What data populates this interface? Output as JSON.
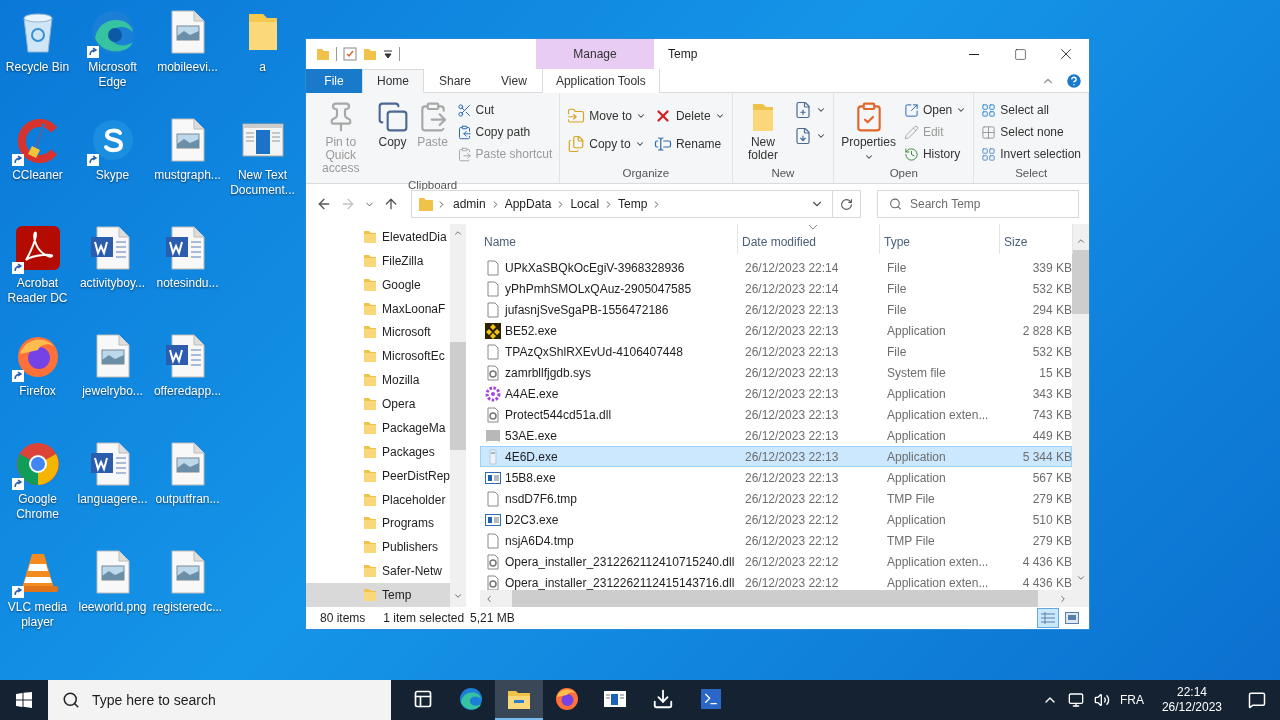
{
  "desktop": {
    "icons": [
      {
        "label": "Recycle Bin",
        "kind": "recycle",
        "shortcut": false
      },
      {
        "label": "CCleaner",
        "kind": "ccleaner",
        "shortcut": true
      },
      {
        "label": "Acrobat Reader DC",
        "kind": "acrobat",
        "shortcut": true
      },
      {
        "label": "Firefox",
        "kind": "firefox",
        "shortcut": true
      },
      {
        "label": "Google Chrome",
        "kind": "chrome",
        "shortcut": true
      },
      {
        "label": "VLC media player",
        "kind": "vlc",
        "shortcut": true
      },
      {
        "label": "Microsoft Edge",
        "kind": "edge",
        "shortcut": true
      },
      {
        "label": "Skype",
        "kind": "skype",
        "shortcut": true
      },
      {
        "label": "activityboy...",
        "kind": "word",
        "shortcut": false
      },
      {
        "label": "jewelrybo...",
        "kind": "image",
        "shortcut": false
      },
      {
        "label": "languagere...",
        "kind": "word",
        "shortcut": false
      },
      {
        "label": "leeworld.png",
        "kind": "image",
        "shortcut": false
      },
      {
        "label": "mobileevi...",
        "kind": "image",
        "shortcut": false
      },
      {
        "label": "mustgraph...",
        "kind": "image",
        "shortcut": false
      },
      {
        "label": "notesindu...",
        "kind": "word",
        "shortcut": false
      },
      {
        "label": "offeredapp...",
        "kind": "word",
        "shortcut": false
      },
      {
        "label": "outputfran...",
        "kind": "image",
        "shortcut": false
      },
      {
        "label": "registeredc...",
        "kind": "image",
        "shortcut": false
      },
      {
        "label": "a",
        "kind": "folder",
        "shortcut": false
      },
      {
        "label": "New Text Document...",
        "kind": "window",
        "shortcut": false
      }
    ]
  },
  "window": {
    "contextual_tab": "Manage",
    "title": "Temp",
    "tabs": [
      {
        "label": "File",
        "kind": "file",
        "selected": false
      },
      {
        "label": "Home",
        "kind": "tab",
        "selected": true
      },
      {
        "label": "Share",
        "kind": "tab",
        "selected": false
      },
      {
        "label": "View",
        "kind": "tab",
        "selected": false
      },
      {
        "label": "Application Tools",
        "kind": "contextual",
        "selected": false
      }
    ],
    "ribbon": {
      "groups": [
        {
          "label": "Clipboard",
          "columns": [
            [
              {
                "label": "Pin to Quick access",
                "kind": "large",
                "dropdown": false,
                "disabled": true
              }
            ],
            [
              {
                "label": "Copy",
                "kind": "large",
                "dropdown": false,
                "disabled": false
              }
            ],
            [
              {
                "label": "Paste",
                "kind": "large",
                "dropdown": false,
                "disabled": true
              }
            ],
            [
              {
                "label": "Cut",
                "kind": "small",
                "dropdown": false,
                "disabled": false
              },
              {
                "label": "Copy path",
                "kind": "small",
                "dropdown": false,
                "disabled": false
              },
              {
                "label": "Paste shortcut",
                "kind": "small",
                "dropdown": false,
                "disabled": true
              }
            ]
          ]
        },
        {
          "label": "Organize",
          "columns": [
            [
              {
                "label": "Move to",
                "kind": "medium",
                "dropdown": true,
                "disabled": false
              },
              {
                "label": "Copy to",
                "kind": "medium",
                "dropdown": true,
                "disabled": false
              }
            ],
            [
              {
                "label": "Delete",
                "kind": "medium",
                "dropdown": true,
                "disabled": false
              },
              {
                "label": "Rename",
                "kind": "medium",
                "dropdown": false,
                "disabled": false
              }
            ]
          ]
        },
        {
          "label": "New",
          "columns": [
            [
              {
                "label": "New folder",
                "kind": "large",
                "dropdown": false,
                "disabled": false
              }
            ],
            [
              {
                "kind": "icon",
                "dropdown": true,
                "disabled": false
              },
              {
                "kind": "icon",
                "dropdown": true,
                "disabled": false
              }
            ]
          ]
        },
        {
          "label": "Open",
          "columns": [
            [
              {
                "label": "Properties",
                "kind": "large",
                "dropdown": true,
                "disabled": false
              }
            ],
            [
              {
                "label": "Open",
                "kind": "small",
                "dropdown": true,
                "disabled": false
              },
              {
                "label": "Edit",
                "kind": "small",
                "dropdown": false,
                "disabled": true
              },
              {
                "label": "History",
                "kind": "small",
                "dropdown": false,
                "disabled": false
              }
            ]
          ]
        },
        {
          "label": "Select",
          "columns": [
            [
              {
                "label": "Select all",
                "kind": "small",
                "dropdown": false,
                "disabled": false
              },
              {
                "label": "Select none",
                "kind": "small",
                "dropdown": false,
                "disabled": false
              },
              {
                "label": "Invert selection",
                "kind": "small",
                "dropdown": false,
                "disabled": false
              }
            ]
          ]
        }
      ]
    },
    "address": {
      "breadcrumb": [
        "admin",
        "AppData",
        "Local",
        "Temp"
      ],
      "search_placeholder": "Search Temp"
    },
    "nav": {
      "items": [
        {
          "label": "ElevatedDia",
          "selected": false
        },
        {
          "label": "FileZilla",
          "selected": false
        },
        {
          "label": "Google",
          "selected": false
        },
        {
          "label": "MaxLoonaF",
          "selected": false
        },
        {
          "label": "Microsoft",
          "selected": false
        },
        {
          "label": "MicrosoftEc",
          "selected": false
        },
        {
          "label": "Mozilla",
          "selected": false
        },
        {
          "label": "Opera",
          "selected": false
        },
        {
          "label": "PackageMa",
          "selected": false
        },
        {
          "label": "Packages",
          "selected": false
        },
        {
          "label": "PeerDistRep",
          "selected": false
        },
        {
          "label": "Placeholder",
          "selected": false
        },
        {
          "label": "Programs",
          "selected": false
        },
        {
          "label": "Publishers",
          "selected": false
        },
        {
          "label": "Safer-Netw",
          "selected": false
        },
        {
          "label": "Temp",
          "selected": true
        }
      ]
    },
    "files": {
      "columns": [
        {
          "label": "Name",
          "sorted": false
        },
        {
          "label": "Date modified",
          "sorted": true
        },
        {
          "label": "Type",
          "sorted": false
        },
        {
          "label": "Size",
          "sorted": false
        }
      ],
      "rows": [
        {
          "name": "UPkXaSBQkOcEgiV-3968328936",
          "date": "26/12/2023 22:14",
          "type": "File",
          "size": "339 KB",
          "kind": "blank",
          "selected": false
        },
        {
          "name": "yPhPmhSMOLxQAuz-2905047585",
          "date": "26/12/2023 22:14",
          "type": "File",
          "size": "532 KB",
          "kind": "blank",
          "selected": false
        },
        {
          "name": "jufasnjSveSgaPB-1556472186",
          "date": "26/12/2023 22:13",
          "type": "File",
          "size": "294 KB",
          "kind": "blank",
          "selected": false
        },
        {
          "name": "BE52.exe",
          "date": "26/12/2023 22:13",
          "type": "Application",
          "size": "2 828 KB",
          "kind": "pattern",
          "selected": false
        },
        {
          "name": "TPAzQxShlRXEvUd-4106407448",
          "date": "26/12/2023 22:13",
          "type": "File",
          "size": "532 KB",
          "kind": "blank",
          "selected": false
        },
        {
          "name": "zamrbllfjgdb.sys",
          "date": "26/12/2023 22:13",
          "type": "System file",
          "size": "15 KB",
          "kind": "gear-page",
          "selected": false
        },
        {
          "name": "A4AE.exe",
          "date": "26/12/2023 22:13",
          "type": "Application",
          "size": "343 KB",
          "kind": "gear",
          "selected": false
        },
        {
          "name": "Protect544cd51a.dll",
          "date": "26/12/2023 22:13",
          "type": "Application exten...",
          "size": "743 KB",
          "kind": "gear-page",
          "selected": false
        },
        {
          "name": "53AE.exe",
          "date": "26/12/2023 22:13",
          "type": "Application",
          "size": "449 KB",
          "kind": "grey-app",
          "selected": false
        },
        {
          "name": "4E6D.exe",
          "date": "26/12/2023 22:13",
          "type": "Application",
          "size": "5 344 KB",
          "kind": "white-app",
          "selected": true
        },
        {
          "name": "15B8.exe",
          "date": "26/12/2023 22:13",
          "type": "Application",
          "size": "567 KB",
          "kind": "window",
          "selected": false
        },
        {
          "name": "nsdD7F6.tmp",
          "date": "26/12/2023 22:12",
          "type": "TMP File",
          "size": "279 KB",
          "kind": "blank",
          "selected": false
        },
        {
          "name": "D2C3.exe",
          "date": "26/12/2023 22:12",
          "type": "Application",
          "size": "510 KB",
          "kind": "window",
          "selected": false
        },
        {
          "name": "nsjA6D4.tmp",
          "date": "26/12/2023 22:12",
          "type": "TMP File",
          "size": "279 KB",
          "kind": "blank",
          "selected": false
        },
        {
          "name": "Opera_installer_2312262112410715240.dll",
          "date": "26/12/2023 22:12",
          "type": "Application exten...",
          "size": "4 436 KB",
          "kind": "gear-page",
          "selected": false
        },
        {
          "name": "Opera_installer_2312262112415143716.dll",
          "date": "26/12/2023 22:12",
          "type": "Application exten...",
          "size": "4 436 KB",
          "kind": "gear-page",
          "selected": false
        }
      ]
    },
    "status_bar": {
      "count": "80 items",
      "selection": "1 item selected",
      "size": "5,21 MB",
      "views": [
        {
          "kind": "details",
          "selected": true
        },
        {
          "kind": "large-icons",
          "selected": false
        }
      ]
    }
  },
  "taskbar": {
    "search_placeholder": "Type here to search",
    "apps": [
      {
        "kind": "task-view",
        "active": false
      },
      {
        "kind": "edge",
        "active": false
      },
      {
        "kind": "explorer",
        "active": true
      },
      {
        "kind": "firefox",
        "active": false
      },
      {
        "kind": "window",
        "active": false
      },
      {
        "kind": "download",
        "active": false
      },
      {
        "kind": "powershell",
        "active": false
      }
    ],
    "language": "FRA",
    "time": "22:14",
    "date": "26/12/2023"
  }
}
